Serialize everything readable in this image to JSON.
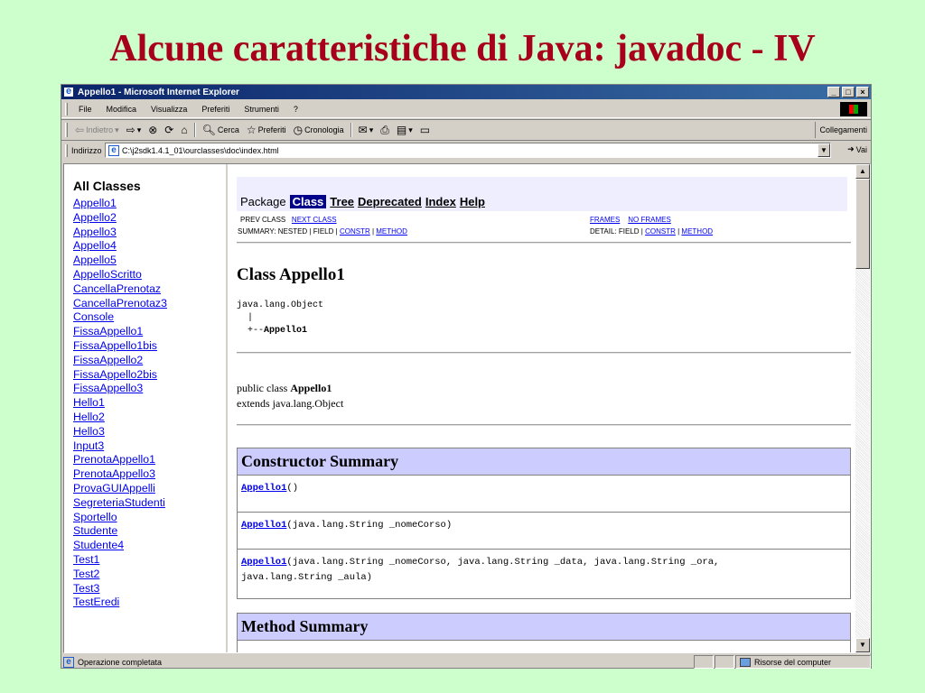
{
  "slide": {
    "title": "Alcune caratteristiche di Java: javadoc - IV"
  },
  "window": {
    "title": "Appello1 - Microsoft Internet Explorer",
    "controls": {
      "minimize": "_",
      "maximize": "□",
      "close": "×"
    }
  },
  "menubar": {
    "items": [
      "File",
      "Modifica",
      "Visualizza",
      "Preferiti",
      "Strumenti",
      "?"
    ]
  },
  "toolbar": {
    "back": "Indietro",
    "search": "Cerca",
    "favorites": "Preferiti",
    "history": "Cronologia",
    "links": "Collegamenti"
  },
  "addressbar": {
    "label": "Indirizzo",
    "url": "C:\\j2sdk1.4.1_01\\ourclasses\\doc\\index.html",
    "go": "Vai"
  },
  "left_frame": {
    "heading": "All Classes",
    "classes": [
      "Appello1",
      "Appello2",
      "Appello3",
      "Appello4",
      "Appello5",
      "AppelloScritto",
      "CancellaPrenotaz",
      "CancellaPrenotaz3",
      "Console",
      "FissaAppello1",
      "FissaAppello1bis",
      "FissaAppello2",
      "FissaAppello2bis",
      "FissaAppello3",
      "Hello1",
      "Hello2",
      "Hello3",
      "Input3",
      "PrenotaAppello1",
      "PrenotaAppello3",
      "ProvaGUIAppelli",
      "SegreteriaStudenti",
      "Sportello",
      "Studente",
      "Studente4",
      "Test1",
      "Test2",
      "Test3",
      "TestEredi"
    ]
  },
  "navbar": {
    "package": "Package",
    "class": "Class",
    "tree": "Tree",
    "deprecated": "Deprecated",
    "index": "Index",
    "help": "Help"
  },
  "subnav": {
    "prev_class": "PREV CLASS",
    "next_class": "NEXT CLASS",
    "frames": "FRAMES",
    "no_frames": "NO FRAMES",
    "summary_prefix": "SUMMARY: NESTED | FIELD |",
    "detail_prefix": "DETAIL: FIELD |",
    "constr": "CONSTR",
    "sep": "|",
    "method": "METHOD"
  },
  "class_doc": {
    "title": "Class Appello1",
    "tree_line1": "java.lang.Object",
    "tree_line2": "  |",
    "tree_line3_prefix": "  +--",
    "tree_line3_name": "Appello1",
    "decl_prefix": "public class ",
    "decl_name": "Appello1",
    "extends": "extends java.lang.Object"
  },
  "constructor_summary": {
    "heading": "Constructor Summary",
    "rows": [
      {
        "name": "Appello1",
        "params": "()"
      },
      {
        "name": "Appello1",
        "params": "(java.lang.String _nomeCorso)"
      },
      {
        "name": "Appello1",
        "params": "(java.lang.String _nomeCorso, java.lang.String _data, java.lang.String _ora,",
        "params2": "java.lang.String _aula)"
      }
    ]
  },
  "method_summary": {
    "heading": "Method Summary"
  },
  "statusbar": {
    "text": "Operazione completata",
    "zone": "Risorse del computer"
  }
}
